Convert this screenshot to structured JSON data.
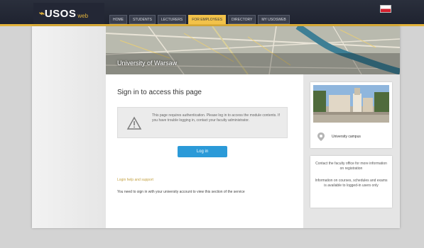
{
  "header": {
    "logo_mark": "⌁",
    "logo_text": "USOS",
    "logo_sub": "web",
    "tabs": [
      {
        "label": "HOME"
      },
      {
        "label": "STUDENTS"
      },
      {
        "label": "LECTURERS"
      },
      {
        "label": "FOR EMPLOYEES"
      },
      {
        "label": "DIRECTORY"
      },
      {
        "label": "MY USOSWEB"
      }
    ],
    "active_tab_index": 3,
    "language_flag": "flag-pl-icon"
  },
  "banner": {
    "title": "University of Warsaw"
  },
  "main": {
    "heading": "Sign in to access this page",
    "notice": {
      "icon": "warning-triangle-icon",
      "text": "This page requires authentication. Please log in to access the module contents. If you have trouble logging in, contact your faculty administrator."
    },
    "login_button": "Log in",
    "small_link": "Login help and support",
    "long_line": "You need to sign in with your university account to view this section of the service"
  },
  "sidebar": {
    "card1": {
      "pin_icon": "location-pin-icon",
      "caption": "University campus"
    },
    "card2": {
      "text1": "Contact the faculty office for more information on registration",
      "text2": "Information on courses, schedules and exams is available to logged-in users only"
    }
  },
  "colors": {
    "topbar": "#1f2330",
    "accent": "#e2b23a",
    "button": "#2b9ad8"
  }
}
